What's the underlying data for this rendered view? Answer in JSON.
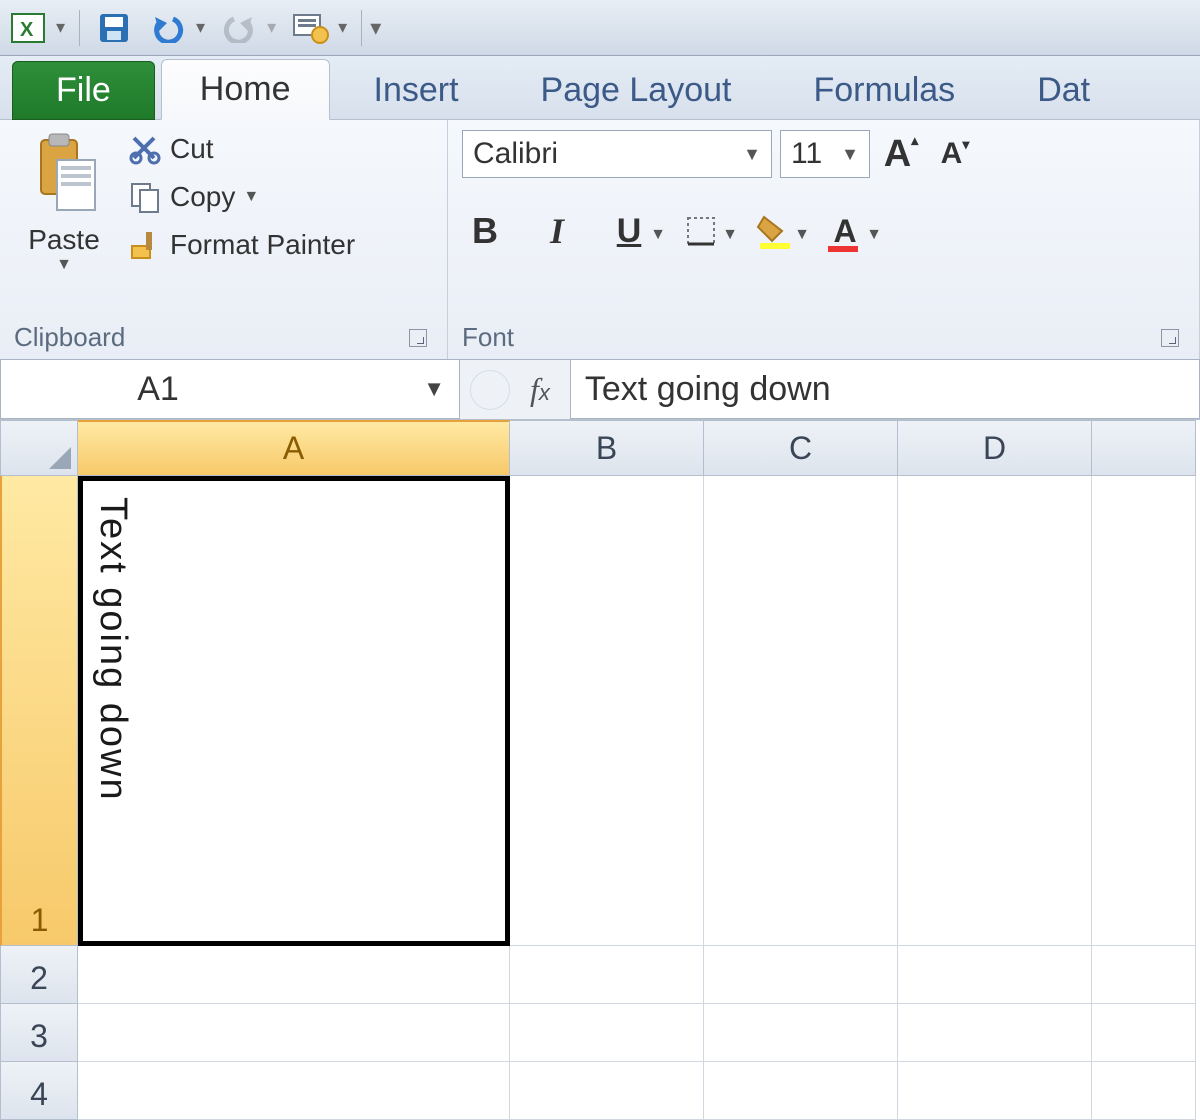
{
  "qat": {
    "tooltip_excel": "Excel",
    "tooltip_save": "Save",
    "tooltip_undo": "Undo",
    "tooltip_redo": "Redo",
    "tooltip_print": "Print Preview"
  },
  "tabs": {
    "file": "File",
    "home": "Home",
    "insert": "Insert",
    "page_layout": "Page Layout",
    "formulas": "Formulas",
    "data": "Dat"
  },
  "clipboard": {
    "paste": "Paste",
    "cut": "Cut",
    "copy": "Copy",
    "format_painter": "Format Painter",
    "group_title": "Clipboard"
  },
  "font": {
    "name": "Calibri",
    "size": "11",
    "group_title": "Font",
    "grow": "A",
    "shrink": "A"
  },
  "name_box": "A1",
  "formula_value": "Text going down",
  "columns": [
    "A",
    "B",
    "C",
    "D"
  ],
  "rows": [
    "1",
    "2",
    "3",
    "4"
  ],
  "cell_A1": "Text going down"
}
